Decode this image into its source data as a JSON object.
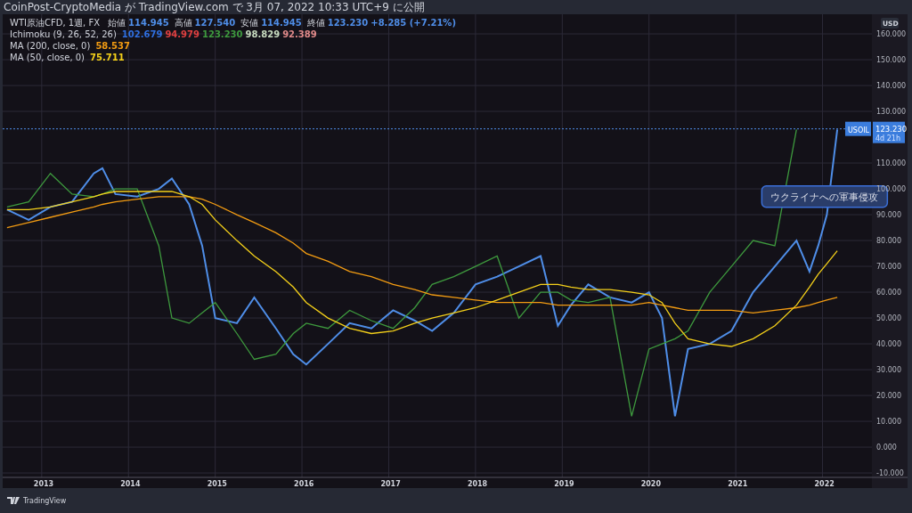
{
  "header": {
    "text": "CoinPost-CryptoMedia が TradingView.com で 3月 07, 2022 10:33 UTC+9 に公開"
  },
  "legend": [
    {
      "title": "WTI原油CFD, 1週, FX",
      "items": [
        {
          "kind": "label",
          "text": "始値"
        },
        {
          "kind": "value",
          "text": "114.945",
          "color": "#4f8ee8"
        },
        {
          "kind": "label",
          "text": "高値"
        },
        {
          "kind": "value",
          "text": "127.540",
          "color": "#4f8ee8"
        },
        {
          "kind": "label",
          "text": "安値"
        },
        {
          "kind": "value",
          "text": "114.945",
          "color": "#4f8ee8"
        },
        {
          "kind": "label",
          "text": "終値"
        },
        {
          "kind": "value",
          "text": "123.230",
          "color": "#4f8ee8"
        },
        {
          "kind": "value",
          "text": "+8.285 (+7.21%)",
          "color": "#4f8ee8"
        }
      ]
    },
    {
      "title": "Ichimoku (9, 26, 52, 26)",
      "items": [
        {
          "kind": "value",
          "text": "102.679",
          "color": "#2f6fe0"
        },
        {
          "kind": "value",
          "text": "94.979",
          "color": "#e04040"
        },
        {
          "kind": "value",
          "text": "123.230",
          "color": "#3e9a3e"
        },
        {
          "kind": "value",
          "text": "98.829",
          "color": "#c8dcc0"
        },
        {
          "kind": "value",
          "text": "92.389",
          "color": "#e08a8a"
        }
      ]
    },
    {
      "title": "MA (200, close, 0)",
      "items": [
        {
          "kind": "value",
          "text": "58.537",
          "color": "#f39c12"
        }
      ]
    },
    {
      "title": "MA (50, close, 0)",
      "items": [
        {
          "kind": "value",
          "text": "75.711",
          "color": "#f5d11a"
        }
      ]
    }
  ],
  "chart": {
    "currency": "USD",
    "price_marker": {
      "symbol": "USOIL",
      "countdown": "4d 21h"
    },
    "chart_data": {
      "type": "line",
      "x": [
        2012.6,
        2012.85,
        2013.1,
        2013.35,
        2013.6,
        2013.7,
        2013.85,
        2014.1,
        2014.35,
        2014.5,
        2014.7,
        2014.85,
        2015.0,
        2015.25,
        2015.45,
        2015.7,
        2015.9,
        2016.05,
        2016.3,
        2016.55,
        2016.8,
        2017.05,
        2017.3,
        2017.5,
        2017.75,
        2018.0,
        2018.25,
        2018.5,
        2018.75,
        2018.95,
        2019.1,
        2019.3,
        2019.55,
        2019.8,
        2020.0,
        2020.15,
        2020.3,
        2020.45,
        2020.7,
        2020.95,
        2021.2,
        2021.45,
        2021.7,
        2021.85,
        2021.95,
        2022.05,
        2022.17
      ],
      "series": [
        {
          "color": "#4f8ee8",
          "values": [
            92,
            88,
            93,
            95,
            106,
            108,
            98,
            97,
            100,
            104,
            94,
            78,
            50,
            48,
            58,
            46,
            36,
            32,
            40,
            48,
            46,
            53,
            49,
            45,
            52,
            63,
            66,
            70,
            74,
            47,
            55,
            63,
            58,
            56,
            60,
            50,
            12,
            38,
            40,
            45,
            60,
            70,
            80,
            68,
            78,
            90,
            123
          ]
        },
        {
          "color": "#3e9a3e",
          "values": [
            93,
            95,
            106,
            98,
            97,
            98,
            100,
            100,
            78,
            50,
            48,
            52,
            56,
            44,
            34,
            36,
            44,
            48,
            46,
            53,
            49,
            46,
            54,
            63,
            66,
            70,
            74,
            50,
            60,
            60,
            57,
            56,
            58,
            12,
            38,
            40,
            42,
            45,
            60,
            70,
            80,
            78,
            123,
            null,
            null,
            null,
            null
          ]
        },
        {
          "color": "#f39c12",
          "values": [
            85,
            87,
            89,
            91,
            93,
            94,
            95,
            96,
            97,
            97,
            97,
            96,
            94,
            90,
            87,
            83,
            79,
            75,
            72,
            68,
            66,
            63,
            61,
            59,
            58,
            57,
            56,
            56,
            56,
            55,
            55,
            55,
            55,
            55,
            56,
            55,
            54,
            53,
            53,
            53,
            52,
            53,
            54,
            55,
            56,
            57,
            58
          ]
        },
        {
          "color": "#f5d11a",
          "values": [
            92,
            92,
            93,
            95,
            97,
            98,
            99,
            99,
            99,
            99,
            97,
            94,
            88,
            80,
            74,
            68,
            62,
            56,
            50,
            46,
            44,
            45,
            48,
            50,
            52,
            54,
            57,
            60,
            63,
            63,
            62,
            61,
            61,
            60,
            59,
            56,
            48,
            42,
            40,
            39,
            42,
            47,
            55,
            62,
            67,
            71,
            76
          ]
        }
      ],
      "grid": true,
      "ref_lines": [
        {
          "axis": "y",
          "value": 123.23,
          "label": "123.230"
        }
      ],
      "xlim": [
        2012.55,
        2022.98
      ],
      "ylim": [
        -11.7,
        167.6
      ],
      "xticks": [
        2013,
        2014,
        2015,
        2016,
        2017,
        2018,
        2019,
        2020,
        2021,
        2022
      ],
      "yticks": [
        {
          "value": -10,
          "label": "-10.000"
        },
        {
          "value": 0,
          "label": "0.000"
        },
        {
          "value": 10,
          "label": "10.000"
        },
        {
          "value": 20,
          "label": "20.000"
        },
        {
          "value": 30,
          "label": "30.000"
        },
        {
          "value": 40,
          "label": "40.000"
        },
        {
          "value": 50,
          "label": "50.000"
        },
        {
          "value": 60,
          "label": "60.000"
        },
        {
          "value": 70,
          "label": "70.000"
        },
        {
          "value": 80,
          "label": "80.000"
        },
        {
          "value": 90,
          "label": "90.000"
        },
        {
          "value": 100,
          "label": "100.000"
        },
        {
          "value": 110,
          "label": "110.000"
        },
        {
          "value": 130,
          "label": "130.000"
        },
        {
          "value": 140,
          "label": "140.000"
        },
        {
          "value": 150,
          "label": "150.000"
        },
        {
          "value": 160,
          "label": "160.000"
        }
      ],
      "annotations": [
        "ウクライナへの軍事侵攻"
      ]
    }
  },
  "footer": {
    "brand": "TradingView"
  }
}
